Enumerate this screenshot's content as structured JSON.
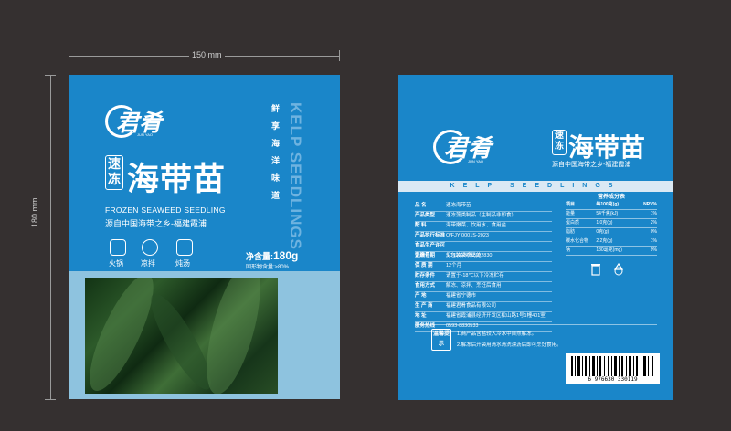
{
  "dimensions": {
    "width_label": "150 mm",
    "height_label": "180 mm"
  },
  "front": {
    "brand": "君肴",
    "brand_en": "JUN YAO",
    "badge": "速冻",
    "product": "海带苗",
    "product_en": "FROZEN SEAWEED SEEDLING",
    "tagline": "源自中国海带之乡-福建霞浦",
    "vertical_cn": "鲜享海洋味道",
    "vertical_en": "KELP SEEDLINGS",
    "uses": [
      {
        "icon": "hotpot-icon",
        "label": "火锅"
      },
      {
        "icon": "salad-icon",
        "label": "凉拌"
      },
      {
        "icon": "soup-icon",
        "label": "炖汤"
      }
    ],
    "net_label": "净含量:",
    "net_value": "180g",
    "solid_ratio": "固形物含量:≥80%"
  },
  "back": {
    "brand": "君肴",
    "brand_en": "JUN YAO",
    "badge": "速冻",
    "product": "海带苗",
    "tagline": "源自中国海带之乡-福建霞浦",
    "band": "KELP SEEDLINGS",
    "info": [
      {
        "k": "品 名",
        "v": "速冻海带苗"
      },
      {
        "k": "产品类型",
        "v": "速冻藻类制品（生制品非即食）"
      },
      {
        "k": "配 料",
        "v": "海带嫩菜、饮用水、食用盐"
      },
      {
        "k": "产品执行标准",
        "v": "Q/FJY 0001S-2023"
      },
      {
        "k": "食品生产许可证编号",
        "v": "SC12235092102830"
      },
      {
        "k": "生产日期",
        "v": "见包装袋喷码处"
      },
      {
        "k": "保 质 期",
        "v": "12个月"
      },
      {
        "k": "贮存条件",
        "v": "请置于-18℃以下冷冻贮存"
      },
      {
        "k": "食用方式",
        "v": "解冻、凉拌、烹饪后食用"
      },
      {
        "k": "产 地",
        "v": "福建省宁德市"
      },
      {
        "k": "生 产 商",
        "v": "福建君肴食品有限公司"
      },
      {
        "k": "地 址",
        "v": "福建省霞浦县经济开发区松山路1号1幢401室"
      },
      {
        "k": "服务热线",
        "v": "0593-8830533"
      }
    ],
    "nutrition": {
      "title": "营养成分表",
      "header": [
        "项目",
        "每100克(g)",
        "NRV%"
      ],
      "rows": [
        [
          "能量",
          "54千焦(kJ)",
          "1%"
        ],
        [
          "蛋白质",
          "1.0克(g)",
          "2%"
        ],
        [
          "脂肪",
          "0克(g)",
          "0%"
        ],
        [
          "碳水化合物",
          "2.2克(g)",
          "1%"
        ],
        [
          "钠",
          "180毫克(mg)",
          "9%"
        ]
      ]
    },
    "barcode": "6 976630 330119",
    "tips_label": "温馨提示",
    "tips": [
      "1.商产品含盐较入冷水中自然解冻。",
      "2.解冻后开袋用清水清洗漂沥后即可烹饪食用。"
    ]
  }
}
